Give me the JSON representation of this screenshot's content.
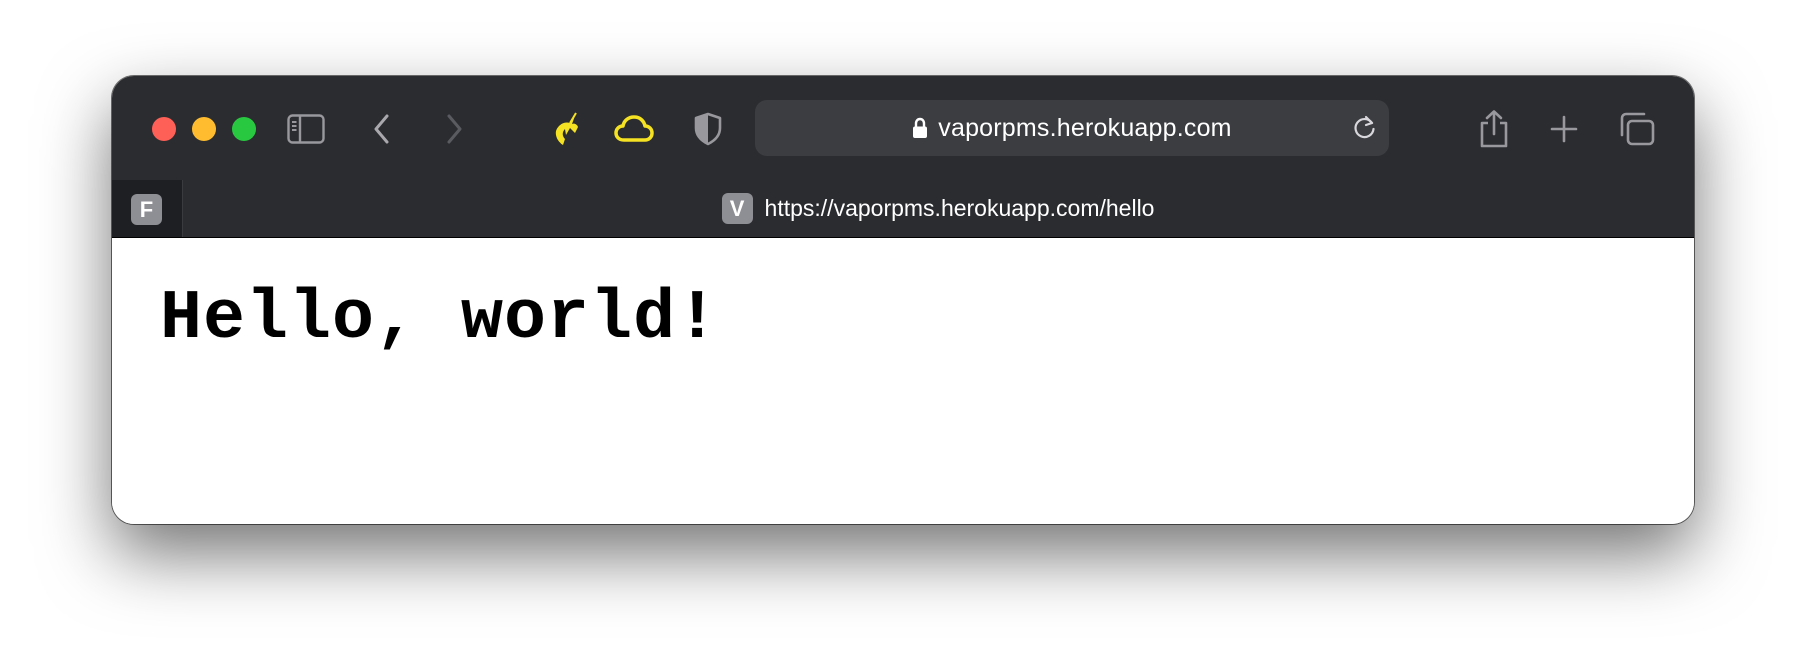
{
  "window": {
    "traffic_lights": [
      "close",
      "minimize",
      "zoom"
    ],
    "colors": {
      "close": "#fe5f57",
      "minimize": "#febc2e",
      "zoom": "#28c840"
    }
  },
  "toolbar": {
    "icons": [
      "sidebar-icon",
      "back-icon",
      "forward-icon",
      "unicorn-extension-icon",
      "cloud-extension-icon",
      "shield-icon",
      "share-icon",
      "plus-icon",
      "tabs-overview-icon"
    ],
    "extension_accent": "#f5e222",
    "url": "vaporpms.herokuapp.com"
  },
  "tabs": {
    "pinned": {
      "favicon_letter": "F"
    },
    "active": {
      "favicon_letter": "V",
      "title": "https://vaporpms.herokuapp.com/hello"
    }
  },
  "page": {
    "heading": "Hello, world!"
  }
}
